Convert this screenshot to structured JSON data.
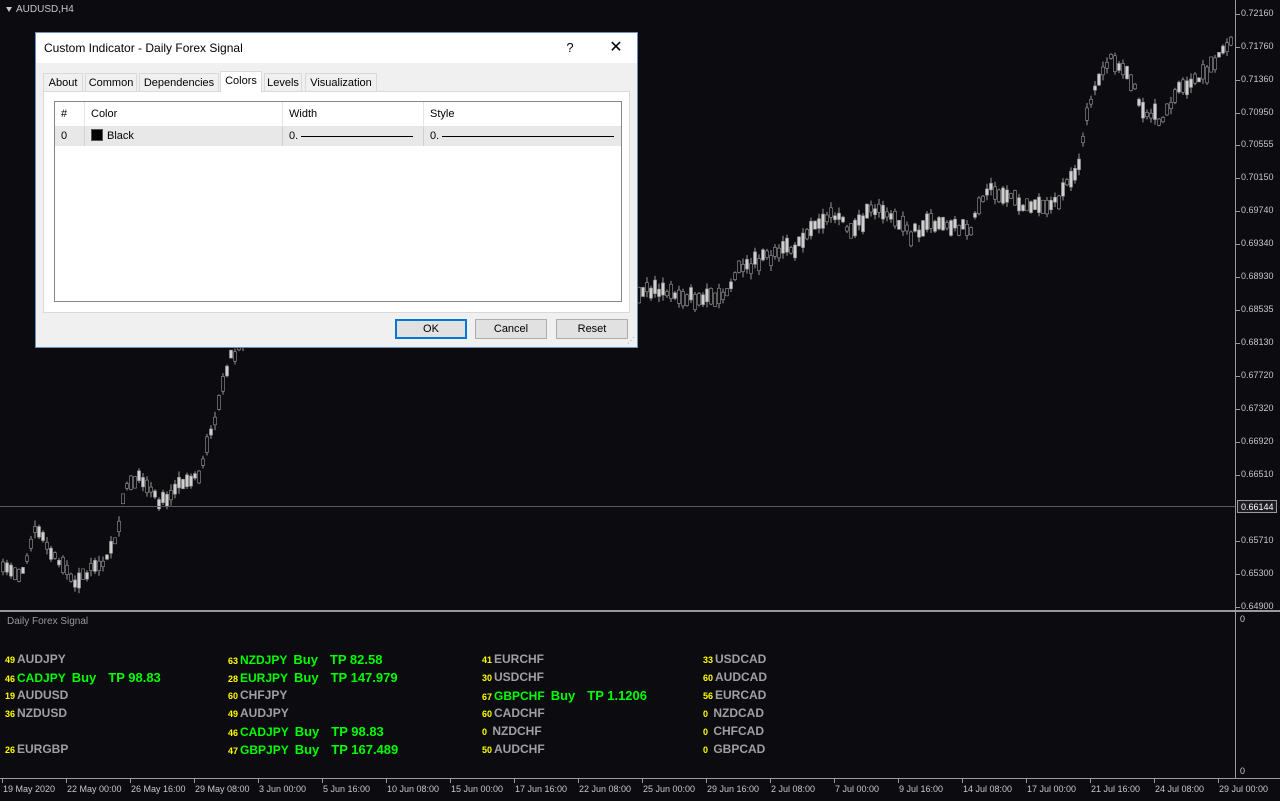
{
  "chart": {
    "symbol_title": "AUDUSD,H4",
    "price_ticks": [
      "0.72160",
      "0.71760",
      "0.71360",
      "0.70950",
      "0.70555",
      "0.70150",
      "0.69740",
      "0.69340",
      "0.68930",
      "0.68535",
      "0.68130",
      "0.67720",
      "0.67320",
      "0.66920",
      "0.66510",
      "0.65710",
      "0.65300",
      "0.64900"
    ],
    "current_price": "0.66144",
    "time_ticks": [
      "19 May 2020",
      "22 May 00:00",
      "26 May 16:00",
      "29 May 08:00",
      "3 Jun 00:00",
      "5 Jun 16:00",
      "10 Jun 08:00",
      "15 Jun 00:00",
      "17 Jun 16:00",
      "22 Jun 08:00",
      "25 Jun 00:00",
      "29 Jun 16:00",
      "2 Jul 08:00",
      "7 Jul 00:00",
      "9 Jul 16:00",
      "14 Jul 08:00",
      "17 Jul 00:00",
      "21 Jul 16:00",
      "24 Jul 08:00",
      "29 Jul 00:00"
    ]
  },
  "indicator": {
    "title": "Daily Forex Signal",
    "axis_top": "0",
    "axis_bottom": "0",
    "columns": [
      [
        {
          "num": "49",
          "pair": "AUDJPY",
          "active": false
        },
        {
          "num": "46",
          "pair": "CADJPY",
          "active": true,
          "action": "Buy",
          "tp": "TP  98.83"
        },
        {
          "num": "19",
          "pair": "AUDUSD",
          "active": false
        },
        {
          "num": "36",
          "pair": "NZDUSD",
          "active": false
        },
        null,
        {
          "num": "26",
          "pair": "EURGBP",
          "active": false
        }
      ],
      [
        {
          "num": "63",
          "pair": "NZDJPY",
          "active": true,
          "action": "Buy",
          "tp": "TP  82.58"
        },
        {
          "num": "28",
          "pair": "EURJPY",
          "active": true,
          "action": "Buy",
          "tp": "TP  147.979"
        },
        {
          "num": "60",
          "pair": "CHFJPY",
          "active": false
        },
        {
          "num": "49",
          "pair": "AUDJPY",
          "active": false
        },
        {
          "num": "46",
          "pair": "CADJPY",
          "active": true,
          "action": "Buy",
          "tp": "TP  98.83"
        },
        {
          "num": "47",
          "pair": "GBPJPY",
          "active": true,
          "action": "Buy",
          "tp": "TP  167.489"
        }
      ],
      [
        {
          "num": "41",
          "pair": "EURCHF",
          "active": false
        },
        {
          "num": "30",
          "pair": "USDCHF",
          "active": false
        },
        {
          "num": "67",
          "pair": "GBPCHF",
          "active": true,
          "action": "Buy",
          "tp": "TP  1.1206"
        },
        {
          "num": "60",
          "pair": "CADCHF",
          "active": false
        },
        {
          "num": "0",
          "pair": " NZDCHF",
          "active": false
        },
        {
          "num": "50",
          "pair": "AUDCHF",
          "active": false
        }
      ],
      [
        {
          "num": "33",
          "pair": "USDCAD",
          "active": false
        },
        {
          "num": "60",
          "pair": "AUDCAD",
          "active": false
        },
        {
          "num": "56",
          "pair": "EURCAD",
          "active": false
        },
        {
          "num": "0",
          "pair": " NZDCAD",
          "active": false
        },
        {
          "num": "0",
          "pair": " CHFCAD",
          "active": false
        },
        {
          "num": "0",
          "pair": " GBPCAD",
          "active": false
        }
      ]
    ]
  },
  "dialog": {
    "title": "Custom Indicator - Daily Forex Signal",
    "help": "?",
    "close": "✕",
    "tabs": [
      "About",
      "Common",
      "Dependencies",
      "Colors",
      "Levels",
      "Visualization"
    ],
    "active_tab": "Colors",
    "grid": {
      "headers": [
        "#",
        "Color",
        "Width",
        "Style"
      ],
      "rows": [
        {
          "index": "0",
          "color_name": "Black",
          "color_hex": "#000000",
          "width": "0.",
          "style": "0."
        }
      ]
    },
    "buttons": {
      "ok": "OK",
      "cancel": "Cancel",
      "reset": "Reset"
    }
  }
}
